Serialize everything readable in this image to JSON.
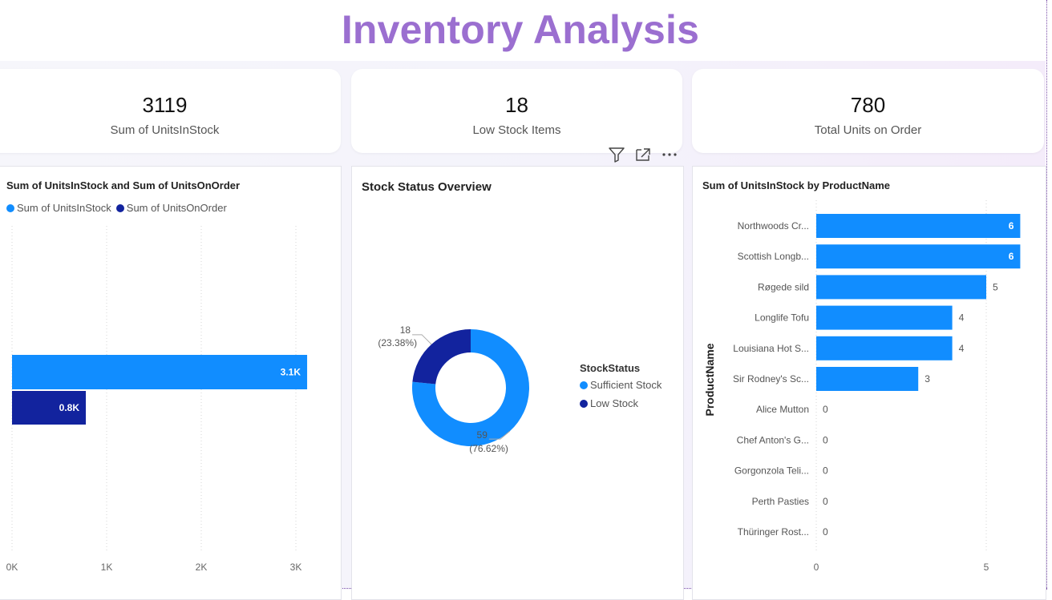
{
  "title": "Inventory Analysis",
  "kpis": [
    {
      "value": "3119",
      "label": "Sum of UnitsInStock"
    },
    {
      "value": "18",
      "label": "Low Stock Items"
    },
    {
      "value": "780",
      "label": "Total Units on Order"
    }
  ],
  "toolbar": {
    "icons": [
      "filter-icon",
      "focus-mode-icon",
      "more-options-icon"
    ]
  },
  "colors": {
    "title": "#9b6fd0",
    "light_blue": "#118dff",
    "dark_blue": "#12239e"
  },
  "chart_data": [
    {
      "type": "bar",
      "orientation": "horizontal",
      "title": "Sum of UnitsInStock and Sum of UnitsOnOrder",
      "categories": [
        ""
      ],
      "series": [
        {
          "name": "Sum of UnitsInStock",
          "values": [
            3119
          ],
          "data_label": "3.1K",
          "color": "#118dff"
        },
        {
          "name": "Sum of UnitsOnOrder",
          "values": [
            780
          ],
          "data_label": "0.8K",
          "color": "#12239e"
        }
      ],
      "xlim": [
        0,
        3300
      ],
      "x_ticks": [
        0,
        1000,
        2000,
        3000
      ],
      "x_tick_labels": [
        "0K",
        "1K",
        "2K",
        "3K"
      ],
      "legend_position": "top-left",
      "grid": true
    },
    {
      "type": "pie",
      "donut": true,
      "title": "Stock Status Overview",
      "legend_title": "StockStatus",
      "slices": [
        {
          "name": "Sufficient Stock",
          "value": 59,
          "percent_label": "(76.62%)",
          "color": "#118dff"
        },
        {
          "name": "Low Stock",
          "value": 18,
          "percent_label": "(23.38%)",
          "color": "#12239e"
        }
      ],
      "legend_position": "right"
    },
    {
      "type": "bar",
      "orientation": "horizontal",
      "title": "Sum of UnitsInStock by ProductName",
      "ylabel": "ProductName",
      "categories": [
        "Northwoods Cr...",
        "Scottish Longb...",
        "Røgede sild",
        "Longlife Tofu",
        "Louisiana Hot S...",
        "Sir Rodney's Sc...",
        "Alice Mutton",
        "Chef Anton's G...",
        "Gorgonzola Teli...",
        "Perth Pasties",
        "Thüringer Rost..."
      ],
      "values": [
        6,
        6,
        5,
        4,
        4,
        3,
        0,
        0,
        0,
        0,
        0
      ],
      "xlim": [
        0,
        6
      ],
      "x_ticks": [
        0,
        5
      ],
      "x_tick_labels": [
        "0",
        "5"
      ],
      "color": "#118dff",
      "grid": true
    }
  ]
}
